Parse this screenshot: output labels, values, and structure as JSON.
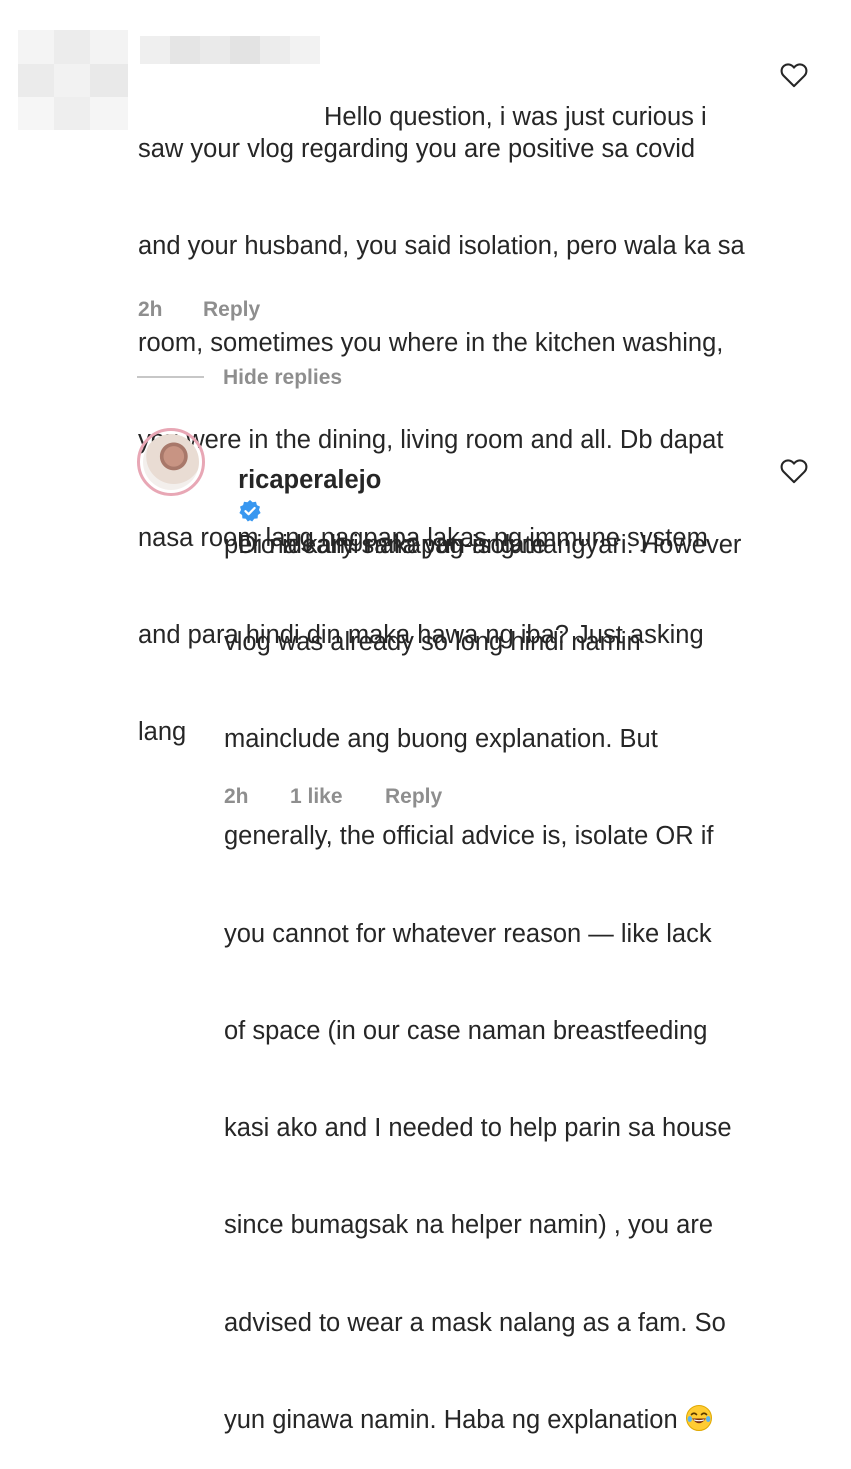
{
  "comment1": {
    "lines": [
      "Hello question, i was just curious i",
      "saw your vlog regarding you are positive sa covid",
      "and your husband, you said isolation, pero wala ka sa",
      "room, sometimes you where in the kitchen washing,",
      "you were in the dining, living room and all. Db dapat",
      "nasa room lang nagpapa lakas ng immune system",
      "and para hindi din maka hawa ng iba? Just asking",
      "lang"
    ],
    "time": "2h",
    "reply_label": "Reply",
    "like_icon": "heart-outline-icon"
  },
  "replies_toggle": {
    "label": "Hide replies"
  },
  "reply1": {
    "username": "ricaperalejo",
    "verified": true,
    "first_line": "Di na kami nakapag-isolate",
    "lines": [
      "pero ideally sana yun ang mangyari. However",
      "vlog was already so long hindi namin",
      "mainclude ang buong explanation. But",
      "generally, the official advice is, isolate OR if",
      "you cannot for whatever reason — like lack",
      "of space (in our case naman breastfeeding",
      "kasi ako and I needed to help parin sa house",
      "since bumagsak na helper namin) , you are",
      "advised to wear a mask nalang as a fam. So"
    ],
    "last_line": "yun ginawa namin. Haba ng explanation",
    "emoji": "laughing-tears-emoji",
    "time": "2h",
    "likes": "1 like",
    "reply_label": "Reply",
    "like_icon": "heart-outline-icon"
  }
}
